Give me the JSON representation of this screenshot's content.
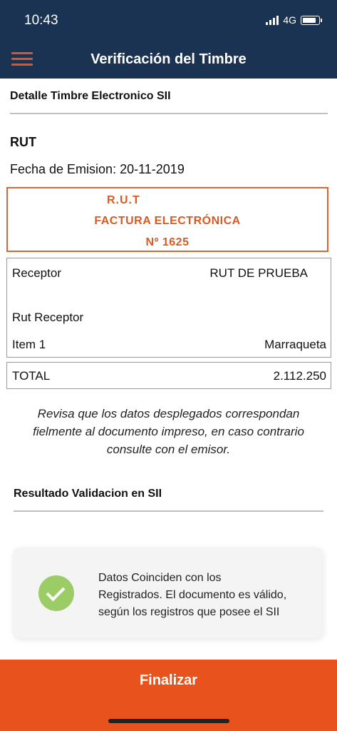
{
  "status_bar": {
    "time": "10:43",
    "network": "4G"
  },
  "header": {
    "title": "Verificación del Timbre"
  },
  "detalle": {
    "section_title": "Detalle Timbre Electronico SII",
    "rut_label": "RUT",
    "fecha_label": "Fecha de Emision:",
    "fecha_value": "20-11-2019"
  },
  "stamp": {
    "rut": "R.U.T",
    "document_type": "FACTURA ELECTRÓNICA",
    "number": "Nº 1625",
    "color": "#e0622c"
  },
  "details": {
    "receptor_label": "Receptor",
    "receptor_value": "RUT DE PRUEBA",
    "rut_receptor_label": "Rut Receptor",
    "item_label": "Item 1",
    "item_value": "Marraqueta",
    "total_label": "TOTAL",
    "total_value": "2.112.250"
  },
  "notice": {
    "line1": "Revisa que los datos desplegados correspondan",
    "line2": "fielmente al documento impreso, en caso contrario",
    "line3": "consulte con el emisor."
  },
  "resultado": {
    "section_title": "Resultado Validacion en SII",
    "line1": "Datos Coinciden con los",
    "line2": "Registrados. El documento es válido,",
    "line3": "según los registros que posee el SII",
    "icon": "check-circle-icon",
    "icon_color": "#9ccc65"
  },
  "footer": {
    "finalize_label": "Finalizar",
    "button_color": "#e8531d"
  },
  "colors": {
    "header_bg": "#1b3352",
    "accent": "#e8501c"
  }
}
